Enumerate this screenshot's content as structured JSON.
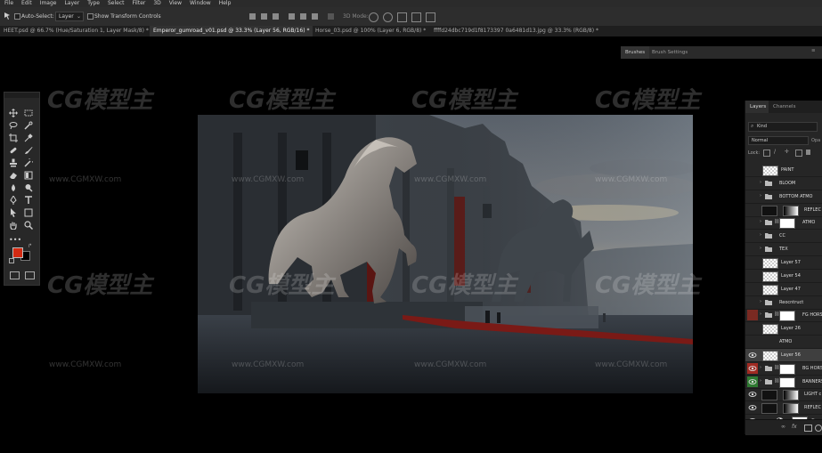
{
  "menu": [
    "File",
    "Edit",
    "Image",
    "Layer",
    "Type",
    "Select",
    "Filter",
    "3D",
    "View",
    "Window",
    "Help"
  ],
  "options": {
    "auto_select_label": "Auto-Select:",
    "auto_select_target": "Layer",
    "transform_controls_label": "Show Transform Controls",
    "mode_3d_label": "3D Mode:"
  },
  "tabs": [
    "HEET.psd @ 66.7% (Hue/Saturation 1, Layer Mask/8) *",
    "Emperor_gumroad_v01.psd @ 33.3% (Layer 56, RGB/16) *",
    "Horse_03.psd @ 100% (Layer 6, RGB/8) *",
    "ffffd24dbc719d1f8173397 0a6481d13.jpg @ 33.3% (RGB/8) *"
  ],
  "brush_panel": {
    "tab1": "Brushes",
    "tab2": "Brush Settings"
  },
  "layers_panel": {
    "tab_layers": "Layers",
    "tab_channels": "Channels",
    "filter_label": "Kind",
    "blend_mode": "Normal",
    "opacity_label": "Opa",
    "lock_label": "Lock:",
    "layers": [
      {
        "name": "PAINT",
        "type": "layer",
        "visible": false
      },
      {
        "name": "BLOOM",
        "type": "group",
        "visible": false
      },
      {
        "name": "BOTTOM ATMO",
        "type": "group",
        "visible": false
      },
      {
        "name": "REFLEC",
        "type": "mask",
        "visible": false
      },
      {
        "name": "ATMO",
        "type": "group-mask",
        "visible": false
      },
      {
        "name": "CC",
        "type": "group",
        "visible": false
      },
      {
        "name": "TEX",
        "type": "group",
        "visible": false
      },
      {
        "name": "Layer 57",
        "type": "layer",
        "visible": false
      },
      {
        "name": "Layer 54",
        "type": "layer",
        "visible": false
      },
      {
        "name": "Layer 47",
        "type": "layer",
        "visible": false
      },
      {
        "name": "Reocntruct",
        "type": "group",
        "visible": false
      },
      {
        "name": "FG HORS",
        "type": "group-mask",
        "visible": false,
        "highlight": "#7a2a22"
      },
      {
        "name": "Layer 26",
        "type": "layer",
        "visible": false
      },
      {
        "name": "ATMO",
        "type": "plain",
        "visible": false
      },
      {
        "name": "Layer 56",
        "type": "layer",
        "visible": true,
        "selected": true
      },
      {
        "name": "BG HORS",
        "type": "group-mask",
        "visible": true,
        "highlight": "#a12a22"
      },
      {
        "name": "BANNERS",
        "type": "group-mask",
        "visible": true,
        "highlight": "#2f7a32"
      },
      {
        "name": "LIGHT c",
        "type": "mask",
        "visible": true
      },
      {
        "name": "REFLEC",
        "type": "mask",
        "visible": true
      },
      {
        "name": "Curv",
        "type": "adjust",
        "visible": true
      }
    ]
  },
  "watermark": {
    "logo": "CG模型主",
    "url": "www.CGMXW.com"
  },
  "colors": {
    "foreground": "#d42a12",
    "background": "#000000",
    "panel": "#262626",
    "ui_dark": "#2d2d2d"
  }
}
